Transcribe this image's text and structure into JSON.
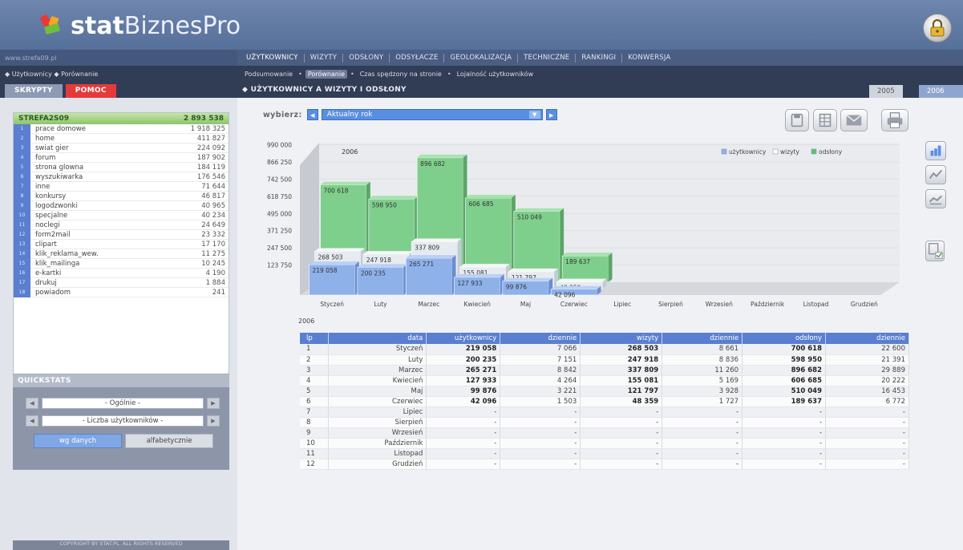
{
  "app": {
    "logo_bold": "stat",
    "logo_rest": "BiznesPro",
    "url": "www.strefa09.pl"
  },
  "nav": {
    "items": [
      "UŻYTKOWNICY",
      "WIZYTY",
      "ODSŁONY",
      "ODSYŁACZE",
      "GEOLOKALIZACJA",
      "TECHNICZNE",
      "RANKINGI",
      "KONWERSJA"
    ],
    "active": "UŻYTKOWNICY"
  },
  "breadcrumb": {
    "text": "◆ Użytkownicy ◆ Porównanie"
  },
  "subnav": {
    "items": [
      "Podsumowanie",
      "Porównanie",
      "Czas spędzony na stronie",
      "Lojalność użytkowników"
    ],
    "active": "Porównanie"
  },
  "sidebar": {
    "tab_scripts": "SKRYPTY",
    "tab_help": "POMOC",
    "site_name": "STREFA2S09",
    "site_total": "2 893 538",
    "rows": [
      {
        "label": "prace domowe",
        "value": "1 918 325"
      },
      {
        "label": "home",
        "value": "411 827"
      },
      {
        "label": "swiat gier",
        "value": "224 092"
      },
      {
        "label": "forum",
        "value": "187 902"
      },
      {
        "label": "strona glowna",
        "value": "184 119"
      },
      {
        "label": "wyszukiwarka",
        "value": "176 546"
      },
      {
        "label": "inne",
        "value": "71 644"
      },
      {
        "label": "konkursy",
        "value": "46 817"
      },
      {
        "label": "logodzwonki",
        "value": "40 965"
      },
      {
        "label": "specjalne",
        "value": "40 234"
      },
      {
        "label": "noclegi",
        "value": "24 649"
      },
      {
        "label": "form2mail",
        "value": "23 332"
      },
      {
        "label": "clipart",
        "value": "17 170"
      },
      {
        "label": "klik_reklama_wew.",
        "value": "11 275"
      },
      {
        "label": "klik_mailinga",
        "value": "10 245"
      },
      {
        "label": "e-kartki",
        "value": "4 190"
      },
      {
        "label": "drukuj",
        "value": "1 884"
      },
      {
        "label": "powiadom",
        "value": "241"
      }
    ]
  },
  "quickstats": {
    "title": "QUICKSTATS",
    "select1": "- Ogólnie -",
    "select2": "- Liczba użytkowników -",
    "btn_by_data": "wg danych",
    "btn_alpha": "alfabetycznie",
    "copyright": "COPYRIGHT BY STAT.PL. ALL RIGHTS RESERVED"
  },
  "main": {
    "title": "◆ UŻYTKOWNICY A WIZYTY I ODSŁONY",
    "year_tabs": [
      "2005",
      "2006"
    ],
    "select_label": "wybierz:",
    "select_value": "Aktualny rok",
    "table_year": "2006"
  },
  "chart_data": {
    "type": "bar",
    "title": "2006",
    "categories": [
      "Styczeń",
      "Luty",
      "Marzec",
      "Kwiecień",
      "Maj",
      "Czerwiec",
      "Lipiec",
      "Sierpień",
      "Wrzesień",
      "Październik",
      "Listopad",
      "Grudzień"
    ],
    "series": [
      {
        "name": "użytkownicy",
        "values": [
          219058,
          200235,
          265271,
          127933,
          99876,
          42096,
          null,
          null,
          null,
          null,
          null,
          null
        ],
        "labels": [
          "219 058",
          "200 235",
          "265 271",
          "127 933",
          "99 876",
          "42 096"
        ]
      },
      {
        "name": "wizyty",
        "values": [
          268503,
          247918,
          337809,
          155081,
          121797,
          48359,
          null,
          null,
          null,
          null,
          null,
          null
        ],
        "labels": [
          "268 503",
          "247 918",
          "337 809",
          "155 081",
          "121 797",
          "48 359"
        ]
      },
      {
        "name": "odsłony",
        "values": [
          700618,
          598950,
          896682,
          606685,
          510049,
          189637,
          null,
          null,
          null,
          null,
          null,
          null
        ],
        "labels": [
          "700 618",
          "598 950",
          "896 682",
          "606 685",
          "510 049",
          "189 637"
        ]
      }
    ],
    "yticks": [
      "123 750",
      "247 500",
      "371 250",
      "495 000",
      "618 750",
      "742 500",
      "866 250",
      "990 000"
    ],
    "ylim": [
      0,
      990000
    ],
    "legend_position": "top-right",
    "colors": {
      "użytkownicy": "#8eb1ea",
      "wizyty": "#e6ebf0",
      "odsłony": "#7fcf8c"
    }
  },
  "table": {
    "headers": [
      "lp",
      "data",
      "użytkownicy",
      "dziennie",
      "wizyty",
      "dziennie",
      "odsłony",
      "dziennie"
    ],
    "rows": [
      [
        "1",
        "Styczeń",
        "219 058",
        "7 066",
        "268 503",
        "8 661",
        "700 618",
        "22 600"
      ],
      [
        "2",
        "Luty",
        "200 235",
        "7 151",
        "247 918",
        "8 836",
        "598 950",
        "21 391"
      ],
      [
        "3",
        "Marzec",
        "265 271",
        "8 842",
        "337 809",
        "11 260",
        "896 682",
        "29 889"
      ],
      [
        "4",
        "Kwiecień",
        "127 933",
        "4 264",
        "155 081",
        "5 169",
        "606 685",
        "20 222"
      ],
      [
        "5",
        "Maj",
        "99 876",
        "3 221",
        "121 797",
        "3 928",
        "510 049",
        "16 453"
      ],
      [
        "6",
        "Czerwiec",
        "42 096",
        "1 503",
        "48 359",
        "1 727",
        "189 637",
        "6 772"
      ],
      [
        "7",
        "Lipiec",
        "-",
        "-",
        "-",
        "-",
        "-",
        "-"
      ],
      [
        "8",
        "Sierpień",
        "-",
        "-",
        "-",
        "-",
        "-",
        "-"
      ],
      [
        "9",
        "Wrzesień",
        "-",
        "-",
        "-",
        "-",
        "-",
        "-"
      ],
      [
        "10",
        "Październik",
        "-",
        "-",
        "-",
        "-",
        "-",
        "-"
      ],
      [
        "11",
        "Listopad",
        "-",
        "-",
        "-",
        "-",
        "-",
        "-"
      ],
      [
        "12",
        "Grudzień",
        "-",
        "-",
        "-",
        "-",
        "-",
        "-"
      ]
    ]
  }
}
